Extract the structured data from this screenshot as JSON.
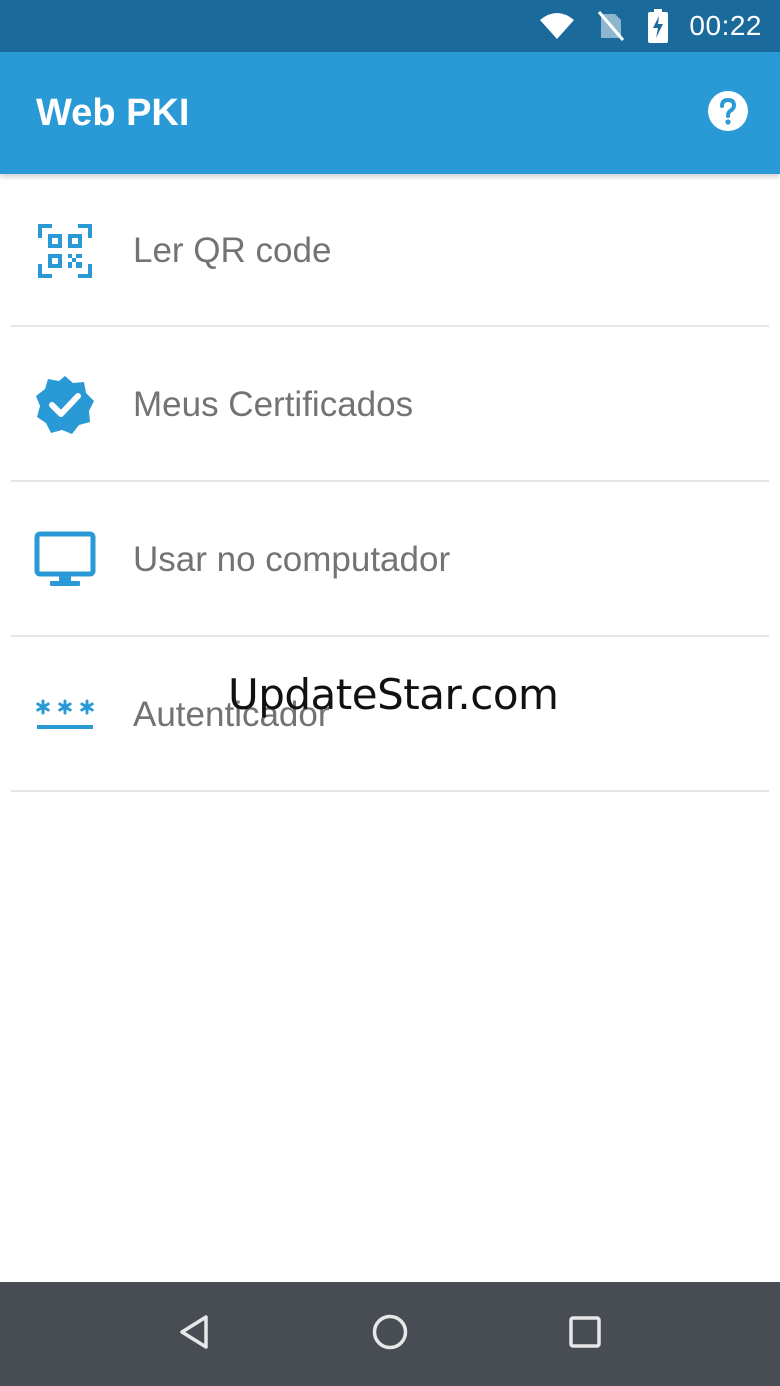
{
  "status_bar": {
    "clock": "00:22",
    "icons": [
      "wifi-icon",
      "no-sim-icon",
      "battery-charging-icon"
    ]
  },
  "app_bar": {
    "title": "Web PKI",
    "help_icon": "help-circle-icon"
  },
  "menu": {
    "items": [
      {
        "label": "Ler QR code",
        "icon": "qr-code-scan-icon"
      },
      {
        "label": "Meus Certificados",
        "icon": "verified-badge-icon"
      },
      {
        "label": "Usar no computador",
        "icon": "desktop-monitor-icon"
      },
      {
        "label": "Autenticador",
        "icon": "password-asterisks-icon"
      }
    ]
  },
  "watermark": "UpdateStar.com",
  "nav_bar": {
    "icons": [
      "back-icon",
      "home-icon",
      "recents-icon"
    ]
  },
  "colors": {
    "accent": "#2a9ad6",
    "status_bar": "#1b6a9c",
    "nav_bar": "#474d52",
    "icon_blue": "#2a9ad6",
    "label_gray": "#737373"
  }
}
